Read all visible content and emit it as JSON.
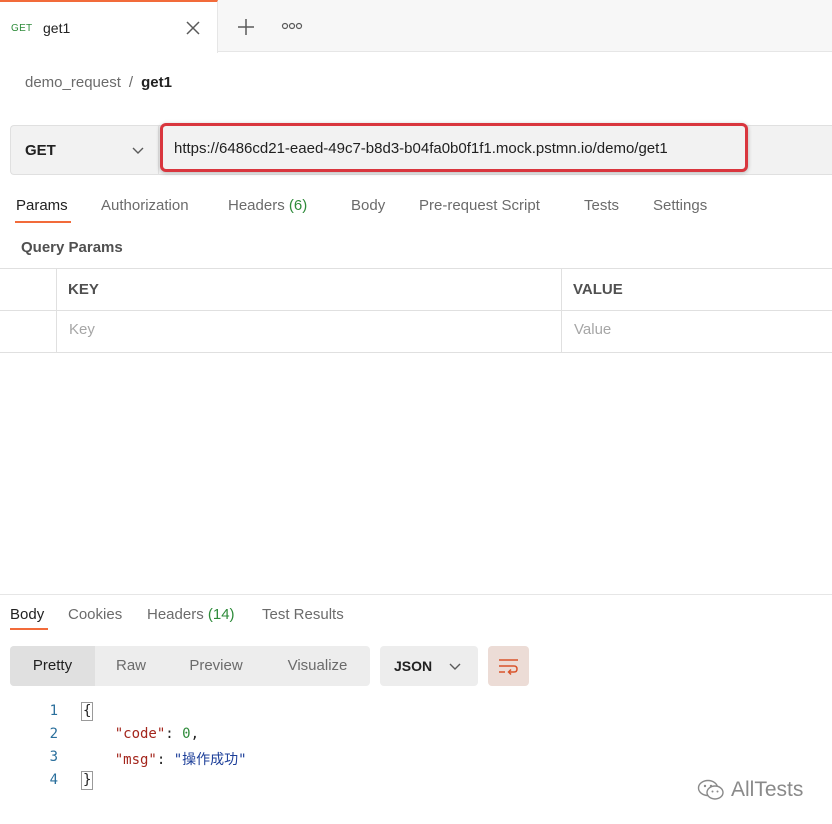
{
  "tab": {
    "method": "GET",
    "title": "get1"
  },
  "breadcrumb": {
    "collection": "demo_request",
    "separator": "/",
    "request": "get1"
  },
  "request": {
    "method": "GET",
    "url": "https://6486cd21-eaed-49c7-b8d3-b04fa0b0f1f1.mock.pstmn.io/demo/get1"
  },
  "request_tabs": [
    {
      "label": "Params",
      "count": ""
    },
    {
      "label": "Authorization",
      "count": ""
    },
    {
      "label": "Headers",
      "count": "(6)"
    },
    {
      "label": "Body",
      "count": ""
    },
    {
      "label": "Pre-request Script",
      "count": ""
    },
    {
      "label": "Tests",
      "count": ""
    },
    {
      "label": "Settings",
      "count": ""
    }
  ],
  "query_params": {
    "title": "Query Params",
    "columns": [
      "KEY",
      "VALUE"
    ],
    "key_placeholder": "Key",
    "value_placeholder": "Value"
  },
  "response_tabs": [
    {
      "label": "Body",
      "count": ""
    },
    {
      "label": "Cookies",
      "count": ""
    },
    {
      "label": "Headers",
      "count": "(14)"
    },
    {
      "label": "Test Results",
      "count": ""
    }
  ],
  "view_modes": [
    "Pretty",
    "Raw",
    "Preview",
    "Visualize"
  ],
  "format": "JSON",
  "code_lines": {
    "numbers": [
      "1",
      "2",
      "3",
      "4"
    ],
    "open_brace": "{",
    "code_key": "\"code\"",
    "code_value": "0",
    "msg_key": "\"msg\"",
    "msg_value": "\"操作成功\"",
    "close_brace": "}"
  },
  "watermark": "AllTests",
  "colors": {
    "accent": "#f26b3a",
    "highlight_border": "#d9363e",
    "count_green": "#2e8b3a"
  }
}
